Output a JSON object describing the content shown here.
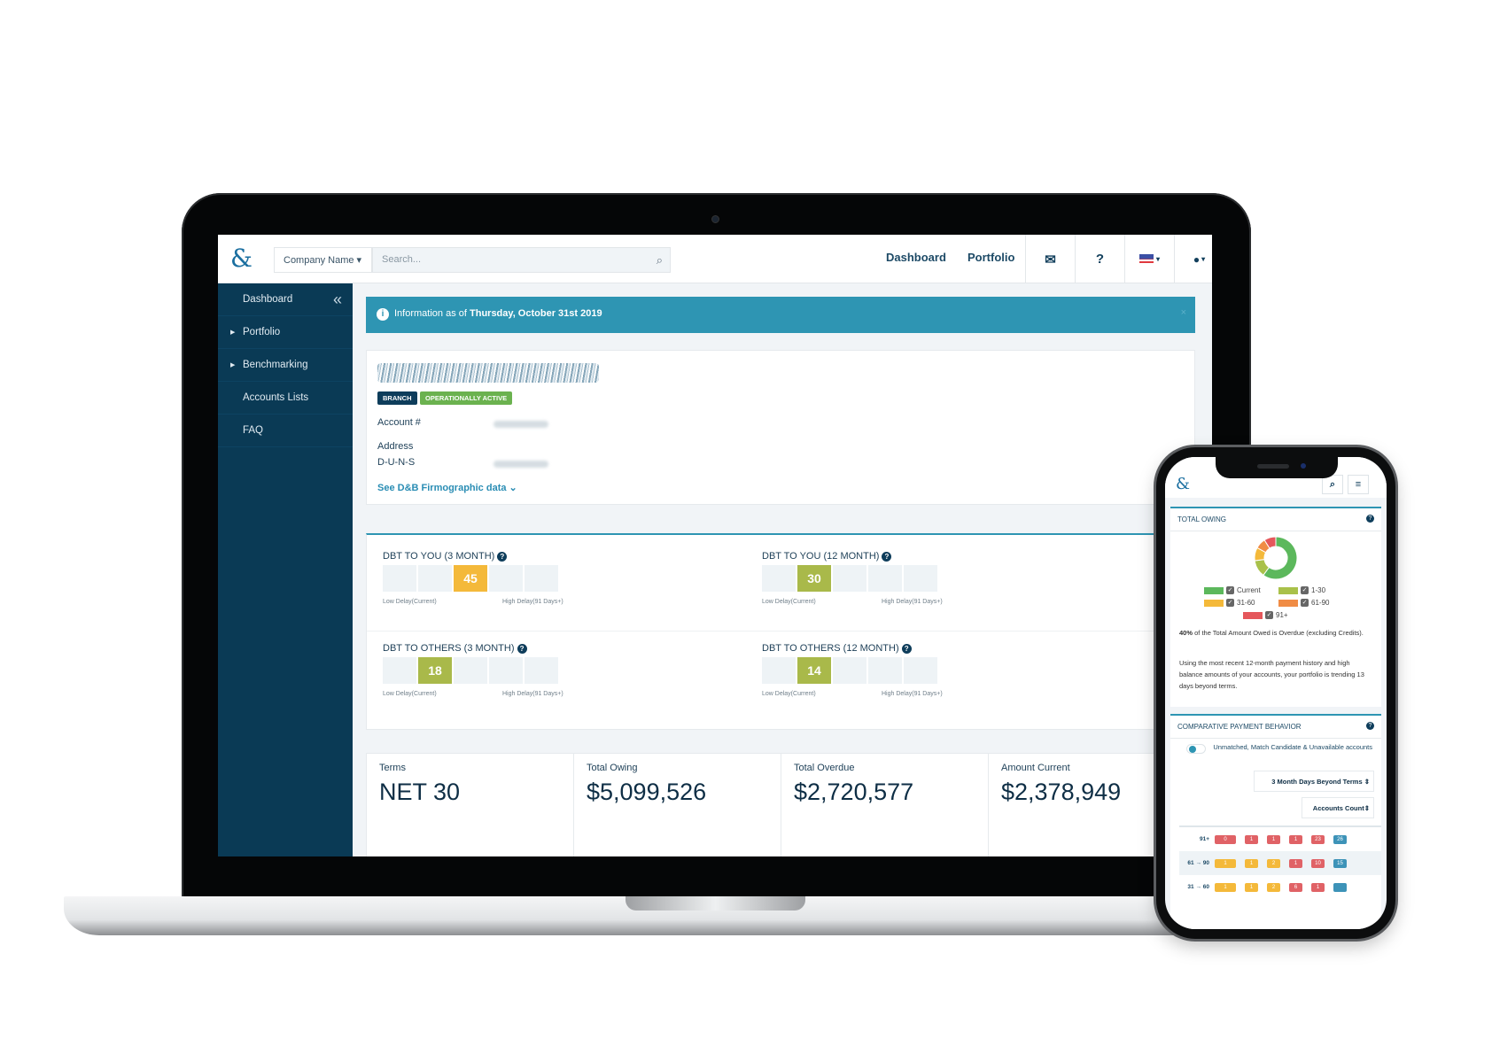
{
  "header": {
    "logo_glyph": "&",
    "company_dropdown": "Company Name ▾",
    "search_placeholder": "Search...",
    "nav": [
      "Dashboard",
      "Portfolio"
    ],
    "icons": {
      "mail": "✉",
      "help": "?",
      "flag": "US",
      "user": "👤"
    }
  },
  "sidebar": {
    "items": [
      {
        "label": "Dashboard",
        "expandable": false
      },
      {
        "label": "Portfolio",
        "expandable": true
      },
      {
        "label": "Benchmarking",
        "expandable": true
      },
      {
        "label": "Accounts Lists",
        "expandable": false
      },
      {
        "label": "FAQ",
        "expandable": false
      }
    ],
    "collapse_glyph": "«"
  },
  "banner": {
    "prefix": "Information as of ",
    "date": "Thursday, October 31st 2019",
    "close": "×"
  },
  "company": {
    "badges": [
      "BRANCH",
      "OPERATIONALLY ACTIVE"
    ],
    "fields": [
      "Account #",
      "Address",
      "D-U-N-S"
    ],
    "firmographic_link": "See D&B Firmographic data ⌄"
  },
  "dbt": [
    {
      "title": "DBT TO YOU (3 MONTH)",
      "value": "45",
      "segment": 3,
      "color": "#f4b93a"
    },
    {
      "title": "DBT TO YOU (12 MONTH)",
      "value": "30",
      "segment": 2,
      "color": "#a9b94a"
    },
    {
      "title": "DBT TO OTHERS (3 MONTH)",
      "value": "18",
      "segment": 2,
      "color": "#a9b94a"
    },
    {
      "title": "DBT TO OTHERS (12 MONTH)",
      "value": "14",
      "segment": 2,
      "color": "#a9b94a"
    }
  ],
  "dbt_scale": {
    "low": "Low Delay(Current)",
    "high": "High Delay(91 Days+)"
  },
  "kpis": [
    {
      "label": "Terms",
      "value": "NET 30"
    },
    {
      "label": "Total Owing",
      "value": "$5,099,526"
    },
    {
      "label": "Total Overdue",
      "value": "$2,720,577"
    },
    {
      "label": "Amount Current",
      "value": "$2,378,949"
    }
  ],
  "mobile": {
    "total_owing": {
      "title": "TOTAL OWING",
      "legend": [
        {
          "label": "Current",
          "color": "#5cb85c"
        },
        {
          "label": "1-30",
          "color": "#a9c14a"
        },
        {
          "label": "31-60",
          "color": "#f4b93a"
        },
        {
          "label": "61-90",
          "color": "#f08c45"
        },
        {
          "label": "91+",
          "color": "#e5575b"
        }
      ],
      "donut_shares": [
        0.6,
        0.13,
        0.1,
        0.08,
        0.09
      ],
      "overdue_pct": "40%",
      "overdue_text": " of the Total Amount Owed is Overdue (excluding Credits).",
      "trend_text": "Using the most recent 12-month payment history and high balance amounts of your accounts, your portfolio is trending 13 days beyond terms."
    },
    "cpb": {
      "title": "COMPARATIVE PAYMENT BEHAVIOR",
      "toggle_label": "Unmatched, Match Candidate & Unavailable accounts",
      "select1": "3 Month Days Beyond Terms ⇕",
      "select2": "Accounts Count⇕",
      "rows": [
        {
          "label": "91+",
          "cells": [
            "0",
            "1",
            "1",
            "1",
            "23",
            "26"
          ],
          "colors": [
            "r",
            "r",
            "r",
            "r",
            "r",
            "b"
          ]
        },
        {
          "label": "61 → 90",
          "cells": [
            "1",
            "1",
            "2",
            "1",
            "10",
            "15"
          ],
          "colors": [
            "y",
            "y",
            "y",
            "r",
            "r",
            "b"
          ]
        },
        {
          "label": "31 → 60",
          "cells": [
            "1",
            "1",
            "2",
            "6",
            "1",
            ""
          ],
          "colors": [
            "y",
            "y",
            "y",
            "r",
            "r",
            "b"
          ]
        }
      ]
    }
  }
}
